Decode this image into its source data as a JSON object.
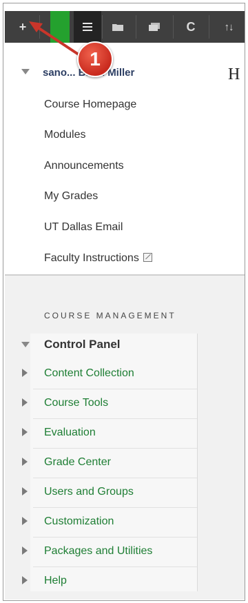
{
  "course_menu": {
    "course_title": "sano... Brian Miller",
    "content_initial": "H",
    "links": [
      "Course Homepage",
      "Modules",
      "Announcements",
      "My Grades",
      "UT Dallas Email",
      "Faculty Instructions"
    ]
  },
  "annotation": {
    "marker_number": "1"
  },
  "toolbar": {
    "add_label": "+",
    "refresh_glyph": "C",
    "sort_glyph": "↑↓"
  },
  "course_management": {
    "header": "COURSE MANAGEMENT",
    "control_panel": {
      "title": "Control Panel",
      "items": [
        "Content Collection",
        "Course Tools",
        "Evaluation",
        "Grade Center",
        "Users and Groups",
        "Customization",
        "Packages and Utilities",
        "Help"
      ]
    }
  },
  "colors": {
    "toolbar_bg": "#3f3f3f",
    "active_green": "#24a12e",
    "link_green": "#1e7e34",
    "marker_red": "#d9362a"
  }
}
